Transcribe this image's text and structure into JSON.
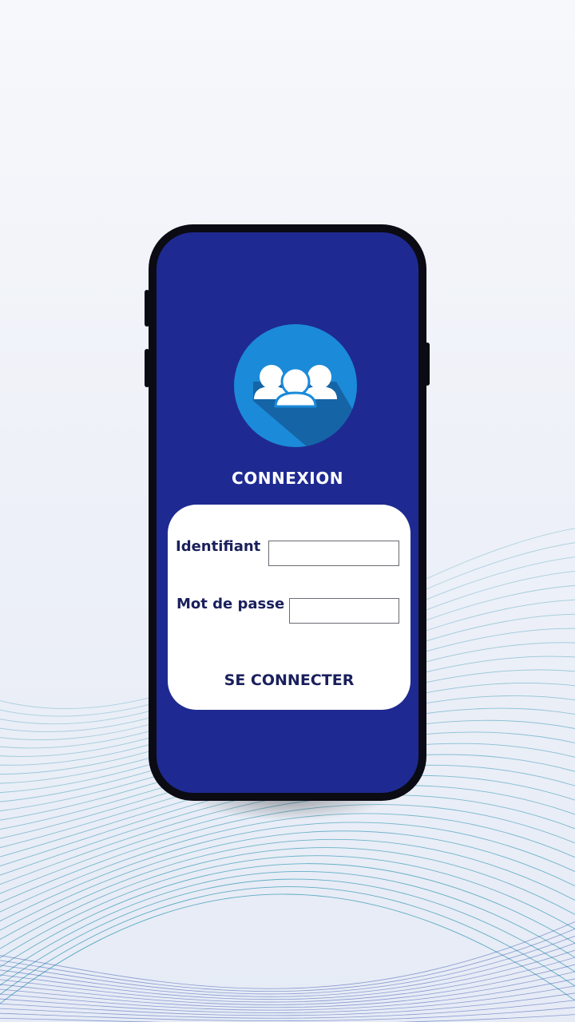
{
  "login": {
    "title": "CONNEXION",
    "username_label": "Identifiant",
    "username_value": "",
    "password_label": "Mot de passe",
    "password_value": "",
    "submit_label": "SE CONNECTER"
  },
  "icons": {
    "avatar": "users-group-icon"
  },
  "colors": {
    "screen_bg": "#1e2a91",
    "avatar_circle": "#1b8ad9",
    "card_bg": "#ffffff",
    "label_text": "#1a1f5c",
    "wave_line": "#3a9bb5"
  }
}
